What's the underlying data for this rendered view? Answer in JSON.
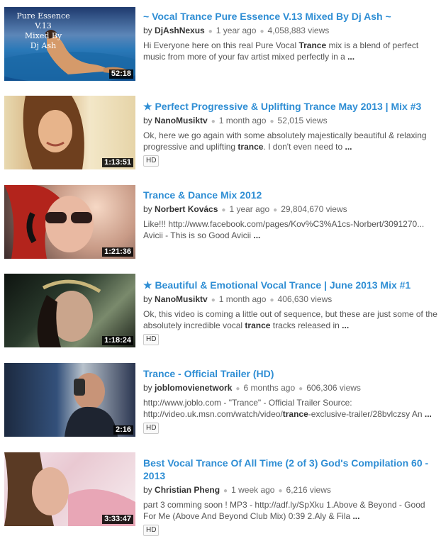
{
  "results": [
    {
      "title": "~ Vocal Trance Pure Essence V.13 Mixed By Dj Ash ~",
      "by": "by",
      "channel": "DjAshNexus",
      "age": "1 year ago",
      "views": "4,058,883 views",
      "desc1": "Hi Everyone here on this real Pure Vocal ",
      "desc_kw": "Trance",
      "desc2": " mix is a blend of perfect music from more of your fav artist mixed perfectly in a ",
      "desc_end": "...",
      "duration": "52:18",
      "thumb_caption": "Pure Essence\nV.13\nMixed By\nDj Ash"
    },
    {
      "title": "★ Perfect Progressive & Uplifting Trance May 2013 | Mix #3",
      "by": "by",
      "channel": "NanoMusiktv",
      "age": "1 month ago",
      "views": "52,015 views",
      "desc1": "Ok, here we go again with some absolutely majestically beautiful & relaxing progressive and uplifting ",
      "desc_kw": "trance",
      "desc2": ". I don't even need to ",
      "desc_end": "...",
      "duration": "1:13:51",
      "badge": "HD"
    },
    {
      "title": "Trance & Dance Mix 2012",
      "by": "by",
      "channel": "Norbert Kovács",
      "age": "1 year ago",
      "views": "29,804,670 views",
      "desc1": "Like!!! http://www.facebook.com/pages/Kov%C3%A1cs-Norbert/3091270... Avicii - This is so Good Avicii ",
      "desc_kw": "",
      "desc2": "",
      "desc_end": "...",
      "duration": "1:21:36"
    },
    {
      "title": "★ Beautiful & Emotional Vocal Trance | June 2013 Mix #1",
      "by": "by",
      "channel": "NanoMusiktv",
      "age": "1 month ago",
      "views": "406,630 views",
      "desc1": "Ok, this video is coming a little out of sequence, but these are just some of the absolutely incredible vocal ",
      "desc_kw": "trance",
      "desc2": " tracks released in ",
      "desc_end": "...",
      "duration": "1:18:24",
      "badge": "HD"
    },
    {
      "title": "Trance - Official Trailer (HD)",
      "by": "by",
      "channel": "joblomovienetwork",
      "age": "6 months ago",
      "views": "606,306 views",
      "desc1": "http://www.joblo.com - \"Trance\" - Official Trailer Source: http://video.uk.msn.com/watch/video/",
      "desc_kw": "trance",
      "desc2": "-exclusive-trailer/28bvlczsy An ",
      "desc_end": "...",
      "duration": "2:16",
      "badge": "HD"
    },
    {
      "title": "Best Vocal Trance Of All Time (2 of 3) God's Compilation 60 - 2013",
      "by": "by",
      "channel": "Christian Pheng",
      "age": "1 week ago",
      "views": "6,216 views",
      "desc1": "part 3 comming soon ! MP3 - http://adf.ly/SpXku 1.Above & Beyond - Good For Me (Above And Beyond Club Mix) 0:39 2.Aly & Fila ",
      "desc_kw": "",
      "desc2": "",
      "desc_end": "...",
      "duration": "3:33:47",
      "badge": "HD"
    }
  ]
}
